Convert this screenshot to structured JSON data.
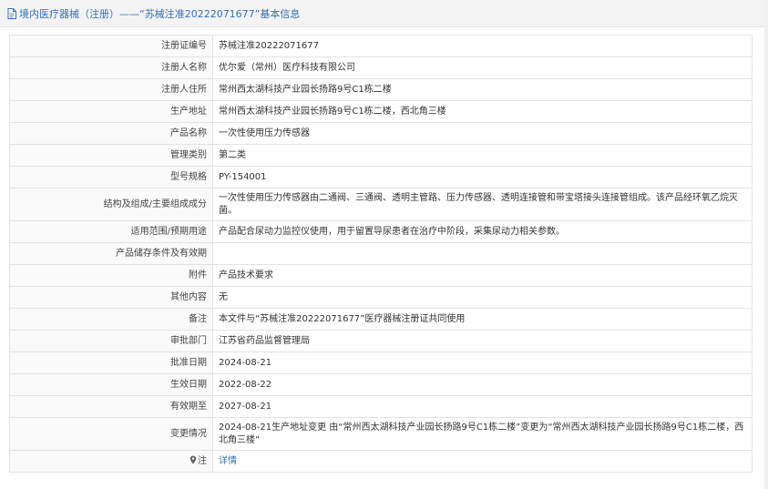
{
  "header": {
    "title": "境内医疗器械（注册）——“苏械注准20222071677”基本信息"
  },
  "rows": [
    {
      "label": "注册证编号",
      "value": "苏械注准20222071677"
    },
    {
      "label": "注册人名称",
      "value": "优尔爱（常州）医疗科技有限公司"
    },
    {
      "label": "注册人住所",
      "value": "常州西太湖科技产业园长扬路9号C1栋二楼"
    },
    {
      "label": "生产地址",
      "value": "常州西太湖科技产业园长扬路9号C1栋二楼，西北角三楼"
    },
    {
      "label": "产品名称",
      "value": "一次性使用压力传感器"
    },
    {
      "label": "管理类别",
      "value": "第二类"
    },
    {
      "label": "型号规格",
      "value": "PY-154001"
    },
    {
      "label": "结构及组成/主要组成成分",
      "value": "一次性使用压力传感器由二通阀、三通阀、透明主管路、压力传感器、透明连接管和带宝塔接头连接管组成。该产品经环氧乙烷灭菌。"
    },
    {
      "label": "适用范围/预期用途",
      "value": "产品配合尿动力监控仪使用，用于留置导尿患者在治疗中阶段，采集尿动力相关参数。"
    },
    {
      "label": "产品储存条件及有效期",
      "value": ""
    },
    {
      "label": "附件",
      "value": "产品技术要求"
    },
    {
      "label": "其他内容",
      "value": "无"
    },
    {
      "label": "备注",
      "value": "本文件与“苏械注准20222071677”医疗器械注册证共同使用"
    },
    {
      "label": "审批部门",
      "value": "江苏省药品监督管理局"
    },
    {
      "label": "批准日期",
      "value": "2024-08-21"
    },
    {
      "label": "生效日期",
      "value": "2022-08-22"
    },
    {
      "label": "有效期至",
      "value": "2027-08-21"
    },
    {
      "label": "变更情况",
      "value": "2024-08-21生产地址变更 由“常州西太湖科技产业园长扬路9号C1栋二楼”变更为“常州西太湖科技产业园长扬路9号C1栋二楼，西北角三楼”"
    }
  ],
  "note_row": {
    "label": "注",
    "icon": "pin-icon",
    "link": "详情"
  },
  "colors": {
    "link": "#3a6fb0",
    "border": "#e3e3e3",
    "header_bg": "#f3f3f3"
  }
}
